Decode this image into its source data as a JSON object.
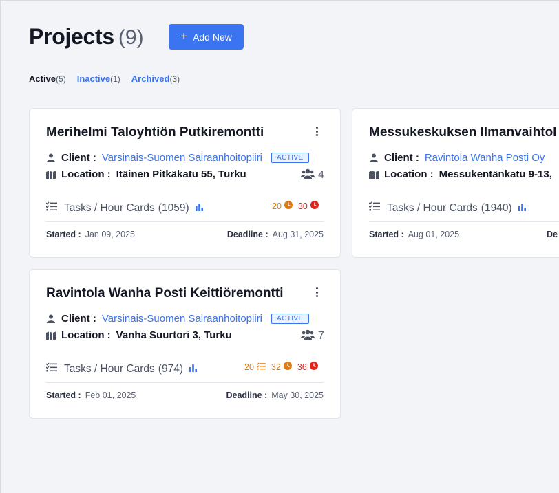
{
  "page": {
    "title": "Projects",
    "count": "(9)",
    "add_label": "Add New"
  },
  "tabs": [
    {
      "label": "Active",
      "count": "(5)"
    },
    {
      "label": "Inactive",
      "count": "(1)"
    },
    {
      "label": "Archived",
      "count": "(3)"
    }
  ],
  "labels": {
    "client": "Client :",
    "location": "Location :",
    "tasks": "Tasks / Hour Cards",
    "started": "Started :",
    "deadline": "Deadline :"
  },
  "cards": [
    {
      "title": "Merihelmi Taloyhtiön Putkiremontti",
      "client": "Varsinais-Suomen Sairaanhoitopiiri",
      "status": "ACTIVE",
      "location": "Itäinen Pitkäkatu 55, Turku",
      "team": "4",
      "tasks_count": "(1059)",
      "stat_clock_orange": "20",
      "stat_clock_red": "30",
      "started": "Jan 09, 2025",
      "deadline": "Aug 31, 2025"
    },
    {
      "title": "Messukeskuksen Ilmanvaihtol",
      "client": "Ravintola Wanha Posti Oy",
      "location": "Messukentänkatu 9-13,",
      "tasks_count": "(1940)",
      "started": "Aug 01, 2025",
      "deadline": "De"
    },
    {
      "title": "Ravintola Wanha Posti Keittiöremontti",
      "client": "Varsinais-Suomen Sairaanhoitopiiri",
      "status": "ACTIVE",
      "location": "Vanha Suurtori 3, Turku",
      "team": "7",
      "tasks_count": "(974)",
      "stat_tasks_orange": "20",
      "stat_clock_orange": "32",
      "stat_clock_red": "36",
      "started": "Feb 01, 2025",
      "deadline": "May 30, 2025"
    }
  ],
  "colors": {
    "accent": "#3a74f0",
    "orange": "#e07b12",
    "red": "#e0241c"
  }
}
